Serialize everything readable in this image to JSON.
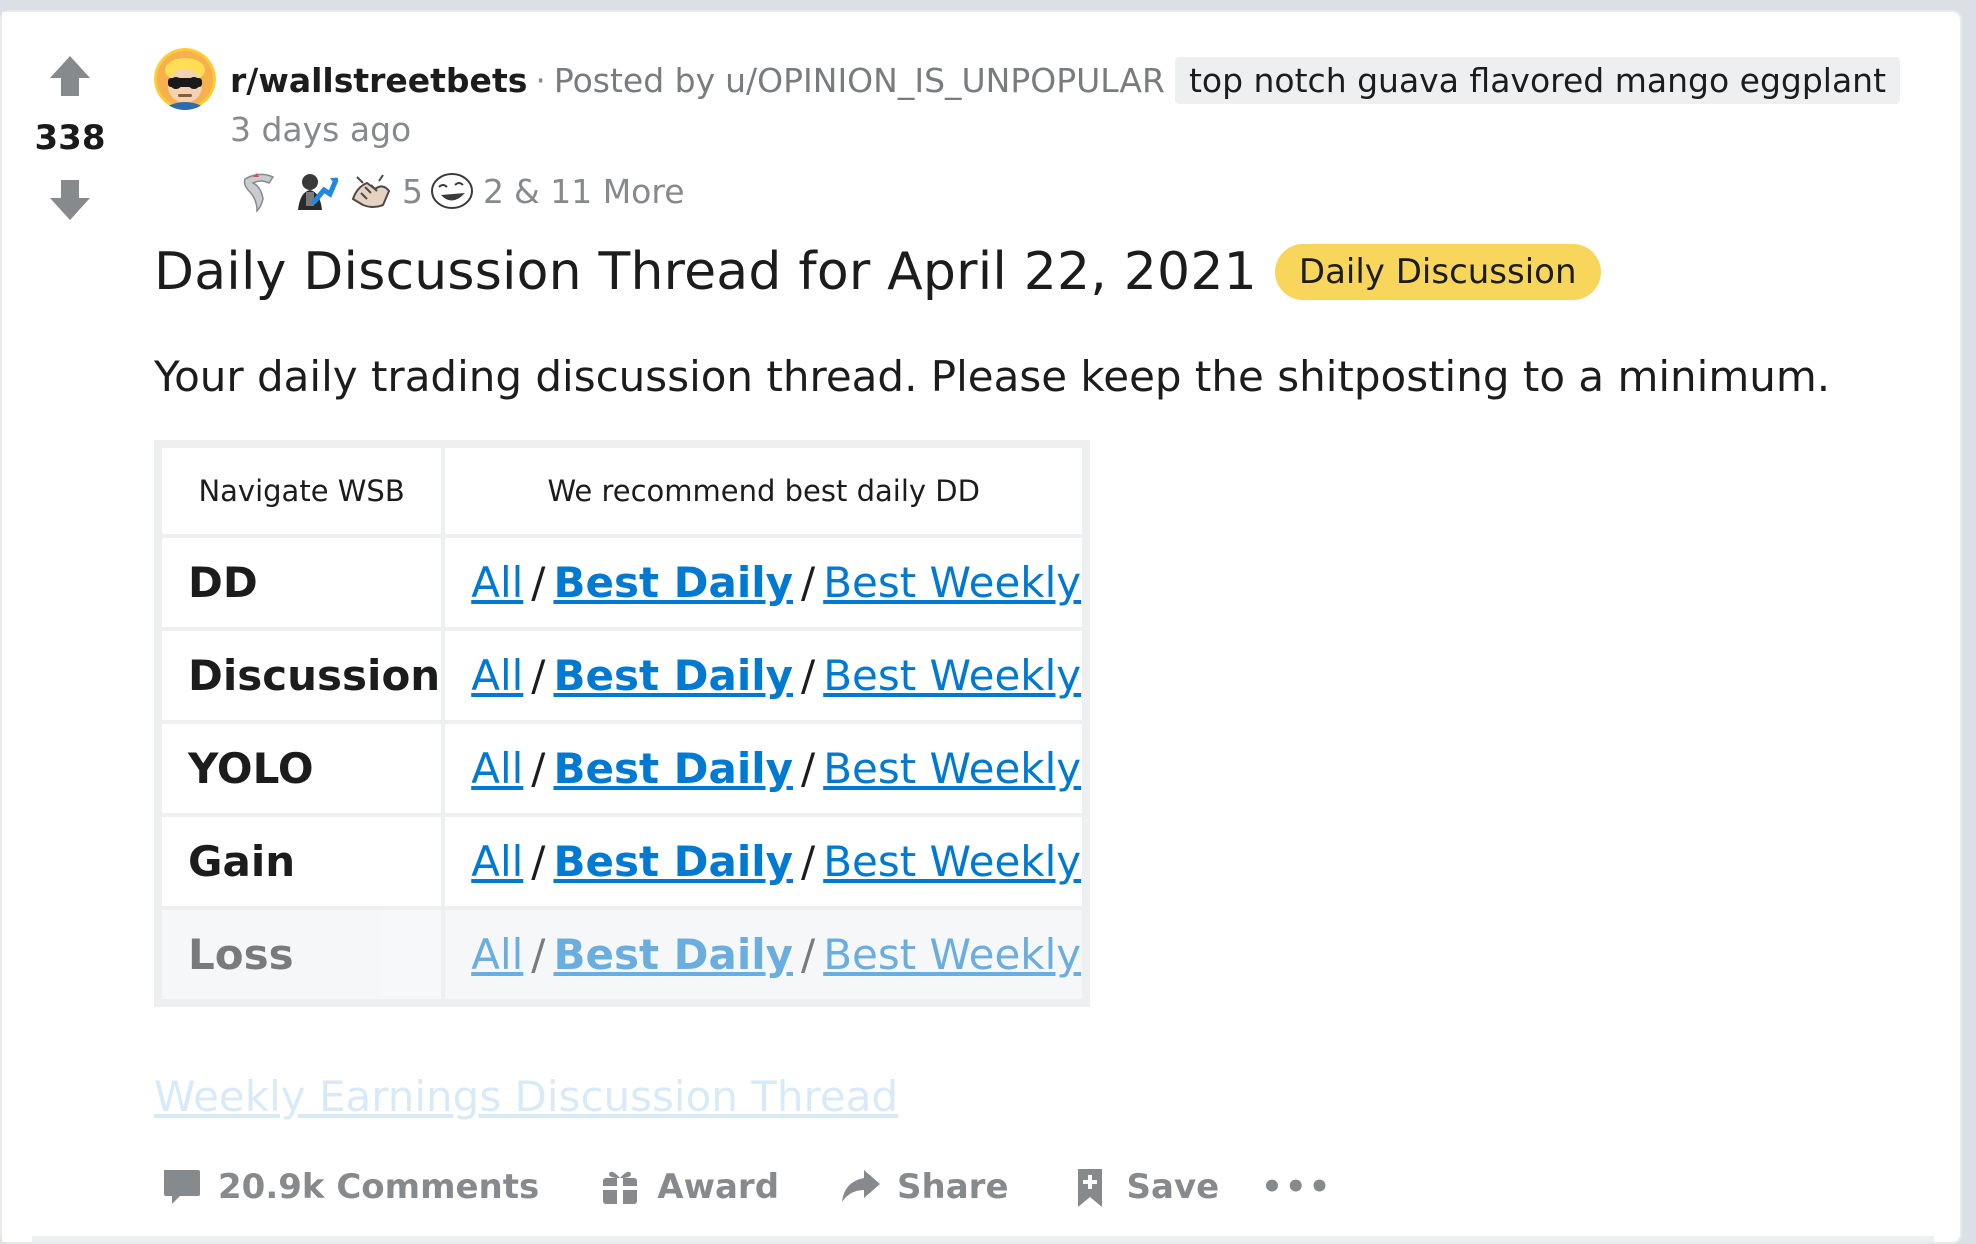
{
  "post": {
    "score": "338",
    "subreddit": "r/wallstreetbets",
    "separator": "·",
    "posted_by_prefix": "Posted by",
    "author": "u/OPINION_IS_UNPOPULAR",
    "user_flair": "top notch guava flavored mango eggplant",
    "timestamp": "3 days ago",
    "awards": [
      {
        "icon": "silver-wings-award-icon",
        "count": ""
      },
      {
        "icon": "stonks-rising-award-icon",
        "count": ""
      },
      {
        "icon": "handshake-award-icon",
        "count": "5"
      },
      {
        "icon": "laughing-face-award-icon",
        "count": "2"
      }
    ],
    "more_awards": "& 11 More",
    "title": "Daily Discussion Thread for April 22, 2021",
    "flair": "Daily Discussion",
    "flair_color": "#f8d65c",
    "body_text": "Your daily trading discussion thread. Please keep the shitposting to a minimum.",
    "weekly_link": "Weekly Earnings Discussion Thread"
  },
  "table": {
    "headers": [
      "Navigate WSB",
      "We recommend best daily DD"
    ],
    "link_labels": {
      "all": "All",
      "best_daily": "Best Daily",
      "best_weekly": "Best Weekly",
      "slash": "/"
    },
    "rows": [
      {
        "category": "DD"
      },
      {
        "category": "Discussion"
      },
      {
        "category": "YOLO"
      },
      {
        "category": "Gain"
      },
      {
        "category": "Loss"
      }
    ]
  },
  "actions": {
    "comments": "20.9k Comments",
    "award": "Award",
    "share": "Share",
    "save": "Save",
    "more": "•••"
  },
  "colors": {
    "link": "#0079d3",
    "muted": "#878a8c",
    "background": "#dae0e6"
  }
}
